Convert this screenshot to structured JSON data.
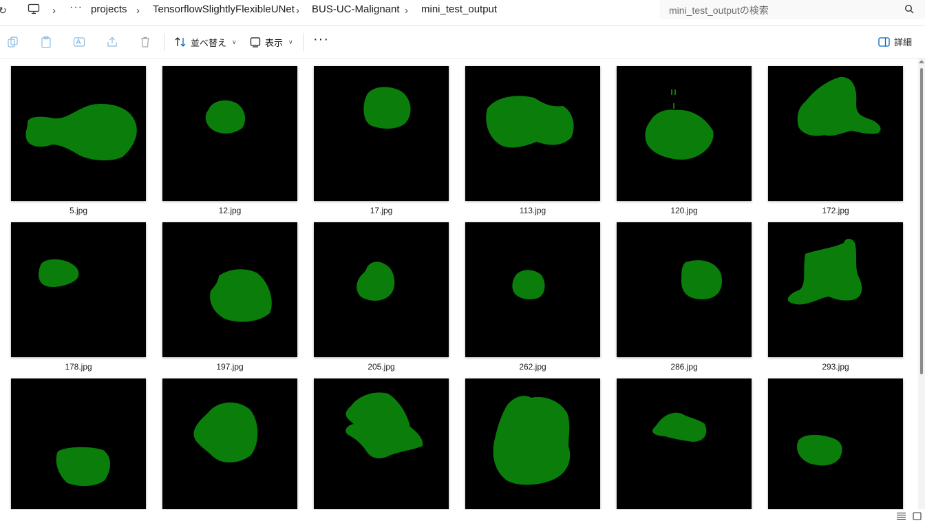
{
  "breadcrumb": {
    "overflow": "···",
    "items": [
      "projects",
      "TensorflowSlightlyFlexibleUNet",
      "BUS-UC-Malignant",
      "mini_test_output"
    ],
    "separator": "›"
  },
  "search": {
    "placeholder": "mini_test_outputの検索"
  },
  "toolbar": {
    "sort_label": "並べ替え",
    "view_label": "表示",
    "more_label": "···",
    "details_label": "詳細"
  },
  "colors": {
    "mask": "#0a7d0a",
    "background": "#000000",
    "accent": "#0067c0"
  },
  "files": {
    "row1": [
      {
        "name": "5.jpg"
      },
      {
        "name": "12.jpg"
      },
      {
        "name": "17.jpg"
      },
      {
        "name": "113.jpg"
      },
      {
        "name": "120.jpg"
      },
      {
        "name": "172.jpg"
      }
    ],
    "row2": [
      {
        "name": "178.jpg"
      },
      {
        "name": "197.jpg"
      },
      {
        "name": "205.jpg"
      },
      {
        "name": "262.jpg"
      },
      {
        "name": "286.jpg"
      },
      {
        "name": "293.jpg"
      }
    ],
    "row3": [
      {
        "name": ""
      },
      {
        "name": ""
      },
      {
        "name": ""
      },
      {
        "name": ""
      },
      {
        "name": ""
      },
      {
        "name": ""
      }
    ]
  }
}
